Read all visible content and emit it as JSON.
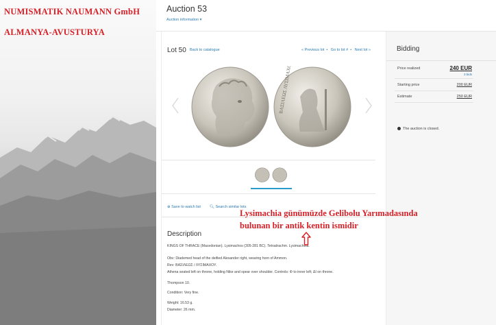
{
  "overlay": {
    "company": "NUMISMATIK NAUMANN GmbH",
    "country": "ALMANYA-AVUSTURYA",
    "annotation_line1": "Lysimachia günümüzde Gelibolu Yarımadasında",
    "annotation_line2": "bulunan bir antik kentin ismidir",
    "accent_color": "#d61f26"
  },
  "header": {
    "auction_title": "Auction 53",
    "auction_info": "Auction information ▾"
  },
  "lot": {
    "number": "Lot 50",
    "back": "Back to catalogue",
    "prev": "« Previous lot",
    "goto": "Go to lot #",
    "next": "Next lot »",
    "watch": "⊕ Save to watch list",
    "similar": "🔍︎ Search similar lots",
    "coin_legend": "ΒΑΣΙΛΕΩΣ ΛΥΣΙΜΑΧΟΥ"
  },
  "description": {
    "heading": "Description",
    "lines": [
      "KINGS OF THRACE (Macedonian). Lysimachos (305-281 BC). Tetradrachm. Lysimacheia.",
      "Obv: Diademed head of the deified Alexander right, wearing horn of Ammon.",
      "Rev: ΒΑΣΙΛΕΩΣ / ΛΥΣΙΜΑΧΟΥ.",
      "Athena seated left on throne, holding Nike and spear over shoulder. Controls: Φ to inner left; ΔΙ on throne.",
      "Thompson 10.",
      "Condition: Very fine.",
      "Weight: 16.53 g.",
      "Diameter: 26 mm."
    ]
  },
  "bidding": {
    "heading": "Bidding",
    "price_realized_label": "Price realized",
    "price_realized": "240 EUR",
    "bids": "3 bids",
    "starting_label": "Starting price",
    "starting": "200 EUR",
    "estimate_label": "Estimate",
    "estimate": "250 EUR",
    "closed": "The auction is closed."
  }
}
